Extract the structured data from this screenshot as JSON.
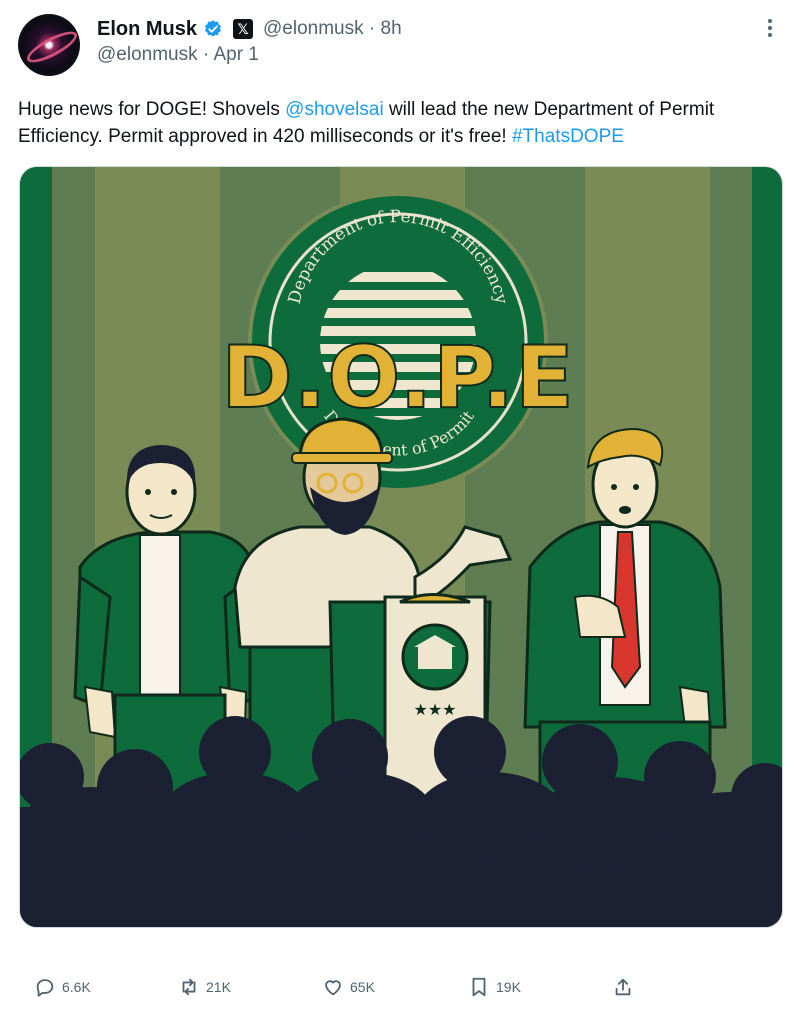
{
  "author": {
    "name": "Elon Musk",
    "handle_repost": "@elonmusk",
    "time_ago": "8h",
    "handle": "@elonmusk",
    "date": "Apr 1"
  },
  "tweet": {
    "text_1": "Huge news for DOGE! Shovels ",
    "mention": "@shovelsai",
    "text_2": " will lead the new Department of Permit Efficiency. Permit approved in 420 milliseconds or it's free! ",
    "hashtag": "#ThatsDOPE"
  },
  "image": {
    "seal_top": "Department of Permit Efficiency",
    "seal_bottom": "Department of Permit",
    "logo": "D.O.P.E"
  },
  "actions": {
    "replies": "6.6K",
    "reposts": "21K",
    "likes": "65K",
    "bookmarks": "19K"
  },
  "colors": {
    "link": "#1d9bf0",
    "green_dark": "#0e6b3c",
    "curtain_light": "#7b8b55",
    "curtain_dark": "#5a7a4f",
    "gold": "#e2b236",
    "silhouette": "#1b2133"
  },
  "icons": [
    "verified-badge-icon",
    "x-logo-icon",
    "more-icon",
    "reply-icon",
    "repost-icon",
    "like-icon",
    "bookmark-icon",
    "share-icon"
  ]
}
